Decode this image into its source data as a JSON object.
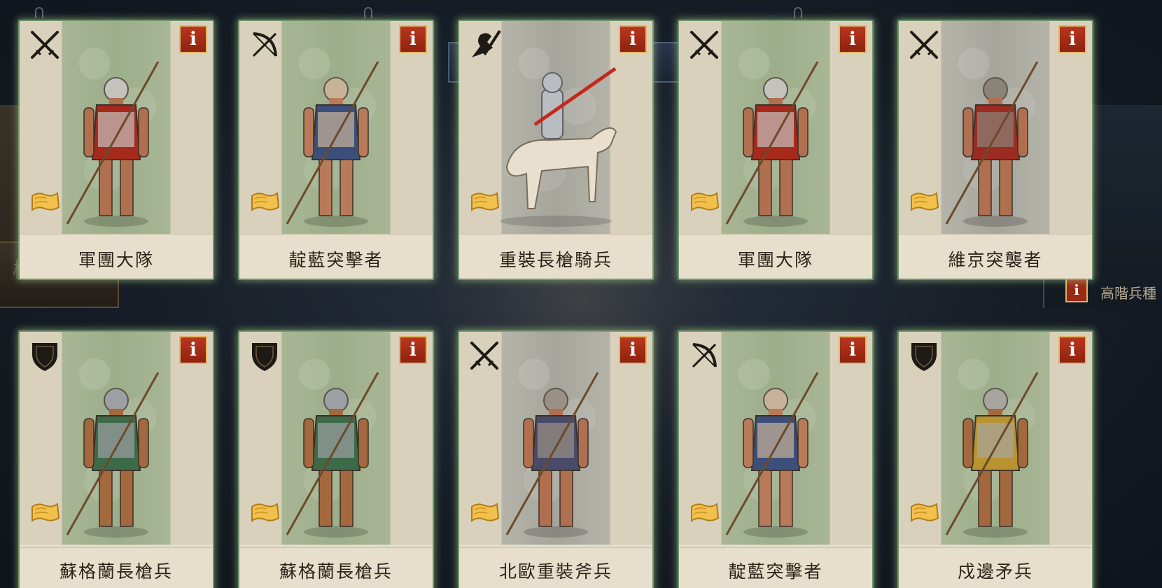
{
  "background": {
    "right_badge": "i",
    "right_text": "高階兵種",
    "left_panel_glyph": "械"
  },
  "colors": {
    "card_glow": "#aadc96",
    "info_button": "#a52d17",
    "card_bg": "#e4dcc7"
  },
  "units": [
    {
      "name": "軍團大隊",
      "type_icon": "swords-icon",
      "info": "i",
      "art": "legion-soldier"
    },
    {
      "name": "靛藍突擊者",
      "type_icon": "bow-icon",
      "info": "i",
      "art": "woad-raider"
    },
    {
      "name": "重裝長槍騎兵",
      "type_icon": "horse-lance-icon",
      "info": "i",
      "art": "lance-knight"
    },
    {
      "name": "軍團大隊",
      "type_icon": "swords-icon",
      "info": "i",
      "art": "legion-soldier"
    },
    {
      "name": "維京突襲者",
      "type_icon": "swords-icon",
      "info": "i",
      "art": "viking-raider"
    },
    {
      "name": "蘇格蘭長槍兵",
      "type_icon": "shield-icon",
      "info": "i",
      "art": "scottish-pikeman"
    },
    {
      "name": "蘇格蘭長槍兵",
      "type_icon": "shield-icon",
      "info": "i",
      "art": "scottish-pikeman"
    },
    {
      "name": "北歐重裝斧兵",
      "type_icon": "swords-icon",
      "info": "i",
      "art": "norse-axeman"
    },
    {
      "name": "靛藍突擊者",
      "type_icon": "bow-icon",
      "info": "i",
      "art": "woad-raider"
    },
    {
      "name": "戍邊矛兵",
      "type_icon": "shield-icon",
      "info": "i",
      "art": "border-spearman"
    }
  ]
}
